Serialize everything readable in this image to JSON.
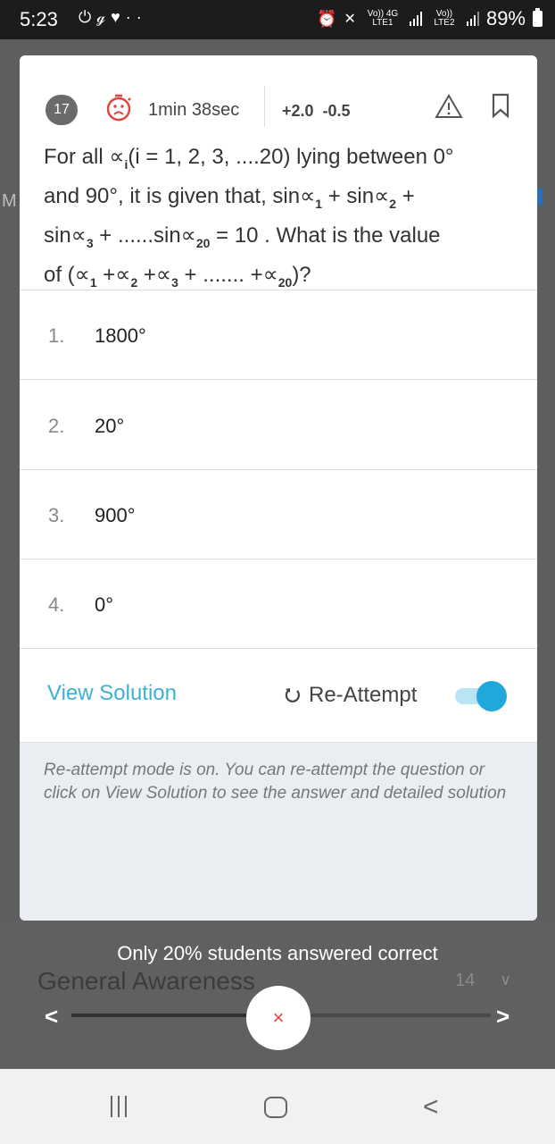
{
  "status_bar": {
    "time": "5:23",
    "left_icons": [
      "power-icon",
      "app-icon",
      "heart-icon",
      "more-dots-icon"
    ],
    "sim1_label": "Vo)) 4G LTE1",
    "sim2_label": "Vo)) LTE2",
    "battery": "89%"
  },
  "background": {
    "left_letter": "M"
  },
  "question": {
    "number": "17",
    "timer": "1min 38sec",
    "marks_positive": "+2.0",
    "marks_negative": "-0.5",
    "lines": [
      "For all ∝",
      "(i = 1, 2, 3, ....20) lying between 0°",
      "and 90°, it is given that, sin∝",
      " + sin∝",
      " +",
      "sin∝",
      " + ......sin∝",
      " = 10 . What is the value",
      "of (∝",
      " +∝",
      " +∝",
      " + ....... +∝",
      ")?"
    ],
    "subscripts": [
      "i",
      "1",
      "2",
      "3",
      "20",
      "1",
      "2",
      "3",
      "20"
    ]
  },
  "options": [
    {
      "num": "1.",
      "text": "1800°"
    },
    {
      "num": "2.",
      "text": "20°"
    },
    {
      "num": "3.",
      "text": "900°"
    },
    {
      "num": "4.",
      "text": "0°"
    }
  ],
  "actions": {
    "view_solution": "View Solution",
    "reattempt": "Re-Attempt",
    "reattempt_mode_on": true
  },
  "info_text": "Re-attempt mode is on. You can re-attempt the question or click on View Solution to see the answer and detailed solution",
  "footer": {
    "stats_text": "Only 20% students answered correct",
    "section_name": "General Awareness",
    "section_count": "14",
    "close_label": "×",
    "progress_fraction": 0.44
  },
  "colors": {
    "accent": "#3bb0d9",
    "toggle_on": "#21a8db",
    "close_red": "#e0463c"
  }
}
